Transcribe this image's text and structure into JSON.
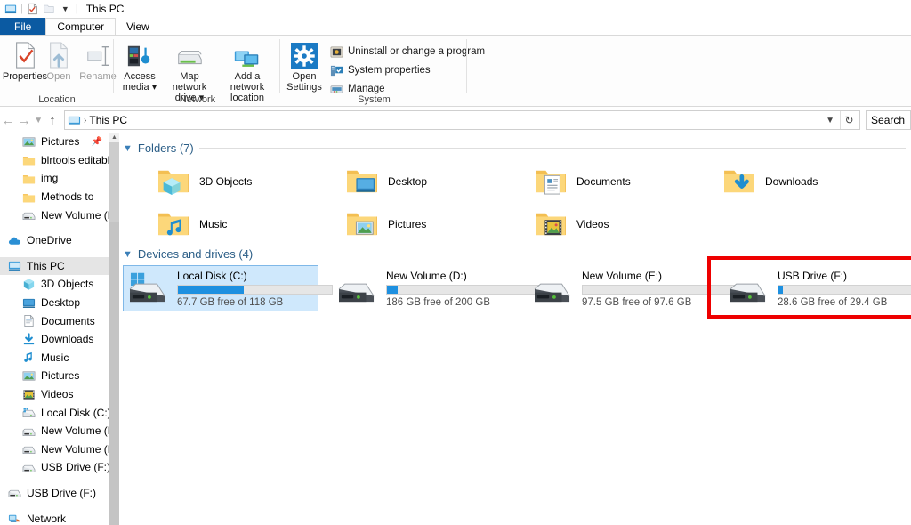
{
  "window": {
    "title": "This PC",
    "quick_access": [
      {
        "name": "this-pc-icon",
        "glyph": "monitor"
      },
      {
        "name": "properties-icon",
        "glyph": "doc-check"
      },
      {
        "name": "new-folder-icon",
        "glyph": "folder-blank"
      },
      {
        "name": "customize-dropdown-icon",
        "glyph": "chevron-down"
      }
    ]
  },
  "tabs": [
    {
      "label": "File",
      "kind": "file"
    },
    {
      "label": "Computer",
      "kind": "active"
    },
    {
      "label": "View",
      "kind": "normal"
    }
  ],
  "ribbon": {
    "groups": [
      {
        "title": "Location",
        "buttons": [
          {
            "label": "Properties",
            "icon": "properties-icon",
            "enabled": true
          },
          {
            "label": "Open",
            "icon": "open-icon",
            "enabled": false
          },
          {
            "label": "Rename",
            "icon": "rename-icon",
            "enabled": false
          }
        ]
      },
      {
        "title": "Network",
        "buttons": [
          {
            "label": "Access media ▾",
            "icon": "access-media-icon",
            "enabled": true
          },
          {
            "label": "Map network drive ▾",
            "icon": "map-network-drive-icon",
            "enabled": true
          },
          {
            "label": "Add a network location",
            "icon": "add-network-location-icon",
            "enabled": true
          }
        ]
      },
      {
        "title": "System",
        "big_button": {
          "label": "Open Settings",
          "icon": "gear-icon"
        },
        "small_buttons": [
          {
            "label": "Uninstall or change a program",
            "icon": "uninstall-program-icon"
          },
          {
            "label": "System properties",
            "icon": "system-properties-icon"
          },
          {
            "label": "Manage",
            "icon": "manage-icon"
          }
        ]
      }
    ]
  },
  "address": {
    "back_icon": "back-arrow-icon",
    "forward_icon": "forward-arrow-icon",
    "recent_icon": "recent-locations-icon",
    "up_icon": "up-arrow-icon",
    "crumb_icon": "this-pc-icon",
    "crumb": "This PC",
    "separator": "›",
    "dropdown_icon": "chevron-down-icon",
    "refresh_icon": "refresh-icon",
    "search_placeholder": "Search"
  },
  "sidebar": {
    "items": [
      {
        "label": "Pictures",
        "icon": "pictures-icon",
        "indent": 2,
        "pinned": true,
        "selected": false
      },
      {
        "label": "blrtools editable",
        "icon": "folder-icon",
        "indent": 2,
        "pinned": false,
        "selected": false
      },
      {
        "label": "img",
        "icon": "folder-icon",
        "indent": 2,
        "pinned": false,
        "selected": false
      },
      {
        "label": "Methods to",
        "icon": "folder-icon",
        "indent": 2,
        "pinned": false,
        "selected": false
      },
      {
        "label": "New Volume (E:)",
        "icon": "drive-icon",
        "indent": 2,
        "pinned": false,
        "selected": false
      },
      {
        "label": "",
        "icon": "spacer",
        "indent": 0,
        "pinned": false,
        "selected": false
      },
      {
        "label": "OneDrive",
        "icon": "onedrive-icon",
        "indent": 1,
        "pinned": false,
        "selected": false
      },
      {
        "label": "",
        "icon": "spacer",
        "indent": 0,
        "pinned": false,
        "selected": false
      },
      {
        "label": "This PC",
        "icon": "this-pc-icon",
        "indent": 1,
        "pinned": false,
        "selected": true
      },
      {
        "label": "3D Objects",
        "icon": "3d-objects-icon",
        "indent": 2,
        "pinned": false,
        "selected": false
      },
      {
        "label": "Desktop",
        "icon": "desktop-icon",
        "indent": 2,
        "pinned": false,
        "selected": false
      },
      {
        "label": "Documents",
        "icon": "documents-icon",
        "indent": 2,
        "pinned": false,
        "selected": false
      },
      {
        "label": "Downloads",
        "icon": "downloads-icon",
        "indent": 2,
        "pinned": false,
        "selected": false
      },
      {
        "label": "Music",
        "icon": "music-icon",
        "indent": 2,
        "pinned": false,
        "selected": false
      },
      {
        "label": "Pictures",
        "icon": "pictures-icon",
        "indent": 2,
        "pinned": false,
        "selected": false
      },
      {
        "label": "Videos",
        "icon": "videos-icon",
        "indent": 2,
        "pinned": false,
        "selected": false
      },
      {
        "label": "Local Disk (C:)",
        "icon": "local-disk-icon",
        "indent": 2,
        "pinned": false,
        "selected": false
      },
      {
        "label": "New Volume (D:)",
        "icon": "drive-icon",
        "indent": 2,
        "pinned": false,
        "selected": false
      },
      {
        "label": "New Volume (E:)",
        "icon": "drive-icon",
        "indent": 2,
        "pinned": false,
        "selected": false
      },
      {
        "label": "USB Drive (F:)",
        "icon": "drive-icon",
        "indent": 2,
        "pinned": false,
        "selected": false
      },
      {
        "label": "",
        "icon": "spacer",
        "indent": 0,
        "pinned": false,
        "selected": false
      },
      {
        "label": "USB Drive (F:)",
        "icon": "drive-icon",
        "indent": 1,
        "pinned": false,
        "selected": false
      },
      {
        "label": "",
        "icon": "spacer",
        "indent": 0,
        "pinned": false,
        "selected": false
      },
      {
        "label": "Network",
        "icon": "network-icon",
        "indent": 1,
        "pinned": false,
        "selected": false
      }
    ]
  },
  "main": {
    "folders_group": {
      "label": "Folders (7)",
      "items": [
        {
          "label": "3D Objects",
          "icon": "folder-3d-objects-icon"
        },
        {
          "label": "Desktop",
          "icon": "folder-desktop-icon"
        },
        {
          "label": "Documents",
          "icon": "folder-documents-icon"
        },
        {
          "label": "Downloads",
          "icon": "folder-downloads-icon"
        },
        {
          "label": "Music",
          "icon": "folder-music-icon"
        },
        {
          "label": "Pictures",
          "icon": "folder-pictures-icon"
        },
        {
          "label": "Videos",
          "icon": "folder-videos-icon"
        }
      ]
    },
    "drives_group": {
      "label": "Devices and drives (4)",
      "items": [
        {
          "name": "Local Disk (C:)",
          "free_text": "67.7 GB free of 118 GB",
          "used_percent": 43,
          "icon": "windows-drive-icon",
          "selected": true,
          "annotated": false
        },
        {
          "name": "New Volume (D:)",
          "free_text": "186 GB free of 200 GB",
          "used_percent": 7,
          "icon": "drive-icon",
          "selected": false,
          "annotated": false
        },
        {
          "name": "New Volume (E:)",
          "free_text": "97.5 GB free of 97.6 GB",
          "used_percent": 0,
          "icon": "drive-icon",
          "selected": false,
          "annotated": false
        },
        {
          "name": "USB Drive (F:)",
          "free_text": "28.6 GB free of 29.4 GB",
          "used_percent": 3,
          "icon": "drive-icon",
          "selected": false,
          "annotated": true
        }
      ]
    }
  },
  "colors": {
    "accent": "#0b5aa2",
    "bar_fill": "#1e90e0",
    "selection": "#cfe8fc",
    "annotation": "#ee0000",
    "group_label": "#2a5d86"
  }
}
